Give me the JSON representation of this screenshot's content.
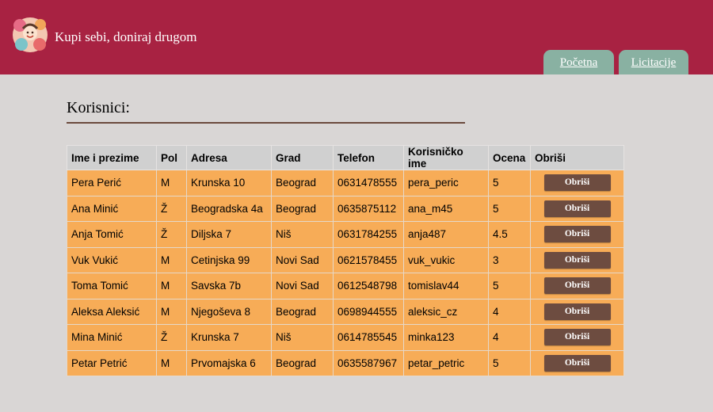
{
  "header": {
    "site_title": "Kupi sebi, doniraj drugom",
    "tabs": [
      {
        "label": "Početna"
      },
      {
        "label": "Licitacije"
      }
    ],
    "colors": {
      "header": "#a82242",
      "tab": "#89b1a2"
    }
  },
  "main": {
    "title": "Korisnici:",
    "table": {
      "columns": [
        "Ime i prezime",
        "Pol",
        "Adresa",
        "Grad",
        "Telefon",
        "Korisničko ime",
        "Ocena",
        "Obriši"
      ],
      "delete_label": "Obriši",
      "rows": [
        {
          "name": "Pera Perić",
          "gender": "M",
          "address": "Krunska 10",
          "city": "Beograd",
          "phone": "0631478555",
          "username": "pera_peric",
          "rating": "5"
        },
        {
          "name": "Ana Minić",
          "gender": "Ž",
          "address": "Beogradska 4a",
          "city": "Beograd",
          "phone": "0635875112",
          "username": "ana_m45",
          "rating": "5"
        },
        {
          "name": "Anja Tomić",
          "gender": "Ž",
          "address": "Diljska 7",
          "city": "Niš",
          "phone": "0631784255",
          "username": "anja487",
          "rating": "4.5"
        },
        {
          "name": "Vuk Vukić",
          "gender": "M",
          "address": "Cetinjska 99",
          "city": "Novi Sad",
          "phone": "0621578455",
          "username": "vuk_vukic",
          "rating": "3"
        },
        {
          "name": "Toma Tomić",
          "gender": "M",
          "address": "Savska 7b",
          "city": "Novi Sad",
          "phone": "0612548798",
          "username": "tomislav44",
          "rating": "5"
        },
        {
          "name": "Aleksa Aleksić",
          "gender": "M",
          "address": "Njegoševa 8",
          "city": "Beograd",
          "phone": "0698944555",
          "username": "aleksic_cz",
          "rating": "4"
        },
        {
          "name": "Mina Minić",
          "gender": "Ž",
          "address": "Krunska 7",
          "city": "Niš",
          "phone": "0614785545",
          "username": "minka123",
          "rating": "4"
        },
        {
          "name": "Petar Petrić",
          "gender": "M",
          "address": "Prvomajska 6",
          "city": "Beograd",
          "phone": "0635587967",
          "username": "petar_petric",
          "rating": "5"
        }
      ]
    },
    "colors": {
      "row": "#f7ac57",
      "header_row": "#d0d0d0",
      "delete_button": "#6d4c40"
    }
  }
}
